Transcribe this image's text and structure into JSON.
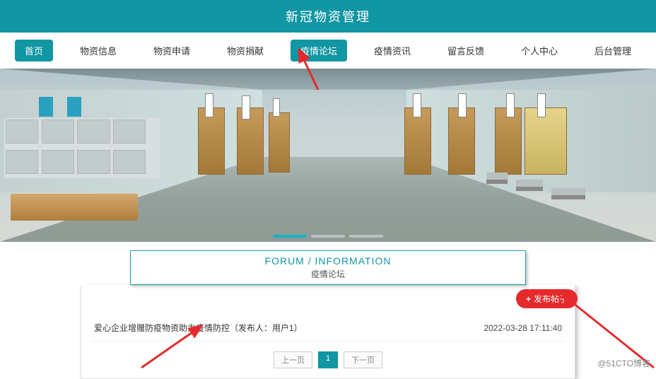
{
  "header": {
    "title": "新冠物资管理"
  },
  "nav": {
    "items": [
      {
        "label": "首页"
      },
      {
        "label": "物资信息"
      },
      {
        "label": "物资申请"
      },
      {
        "label": "物资捐献"
      },
      {
        "label": "疫情论坛"
      },
      {
        "label": "疫情资讯"
      },
      {
        "label": "留言反馈"
      },
      {
        "label": "个人中心"
      },
      {
        "label": "后台管理"
      }
    ]
  },
  "section": {
    "title_en": "FORUM / INFORMATION",
    "title_cn": "疫情论坛"
  },
  "post_button": {
    "plus": "+",
    "label": "发布帖子"
  },
  "posts": [
    {
      "title": "爱心企业增赠防疫物资助力疫情防控（发布人：用户1）",
      "time": "2022-03-28 17:11:40"
    }
  ],
  "pager": {
    "prev": "上一页",
    "current": "1",
    "next": "下一页"
  },
  "watermark": "@51CTO博客"
}
